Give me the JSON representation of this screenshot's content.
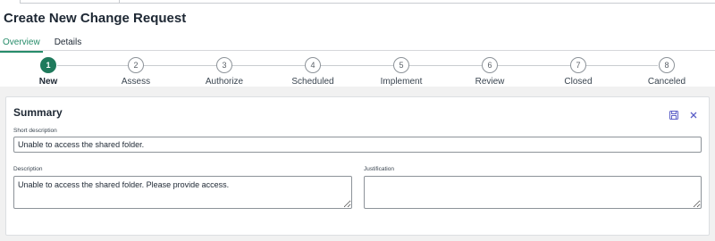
{
  "page": {
    "title": "Create New Change Request"
  },
  "tabs": [
    {
      "label": "Overview",
      "active": true
    },
    {
      "label": "Details",
      "active": false
    }
  ],
  "stepper": {
    "steps": [
      {
        "number": "1",
        "label": "New",
        "active": true
      },
      {
        "number": "2",
        "label": "Assess",
        "active": false
      },
      {
        "number": "3",
        "label": "Authorize",
        "active": false
      },
      {
        "number": "4",
        "label": "Scheduled",
        "active": false
      },
      {
        "number": "5",
        "label": "Implement",
        "active": false
      },
      {
        "number": "6",
        "label": "Review",
        "active": false
      },
      {
        "number": "7",
        "label": "Closed",
        "active": false
      },
      {
        "number": "8",
        "label": "Canceled",
        "active": false
      }
    ]
  },
  "summary": {
    "title": "Summary",
    "icons": {
      "save": "save-icon",
      "close": "close-icon"
    },
    "short_description": {
      "label": "Short description",
      "value": "Unable to access the shared folder."
    },
    "description": {
      "label": "Description",
      "value": "Unable to access the shared folder. Please provide access."
    },
    "justification": {
      "label": "Justification",
      "value": ""
    }
  },
  "colors": {
    "accent": "#278c6a",
    "active_step": "#1f7a5c",
    "icon": "#5b5fc7"
  }
}
